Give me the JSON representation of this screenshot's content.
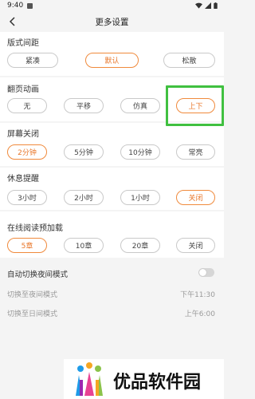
{
  "status_bar": {
    "time": "9:40",
    "icons": [
      "sim-icon",
      "wifi-icon",
      "signal-icon",
      "battery-icon"
    ]
  },
  "header": {
    "title": "更多设置",
    "back_icon": "chevron-left-icon"
  },
  "sections": {
    "layout_spacing": {
      "title": "版式间距",
      "options": [
        "紧凑",
        "默认",
        "松散"
      ],
      "selected": "默认"
    },
    "page_animation": {
      "title": "翻页动画",
      "options": [
        "无",
        "平移",
        "仿真",
        "上下"
      ],
      "selected": "上下"
    },
    "screen_off": {
      "title": "屏幕关闭",
      "options": [
        "2分钟",
        "5分钟",
        "10分钟",
        "常亮"
      ],
      "selected": "2分钟"
    },
    "rest_reminder": {
      "title": "休息提醒",
      "options": [
        "3小时",
        "2小时",
        "1小时",
        "关闭"
      ],
      "selected": "关闭"
    },
    "online_preload": {
      "title": "在线阅读预加载",
      "options": [
        "5章",
        "10章",
        "20章",
        "关闭"
      ],
      "selected": "5章"
    }
  },
  "night_mode": {
    "auto_switch_label": "自动切换夜间模式",
    "auto_switch_enabled": false,
    "to_night_label": "切换至夜间模式",
    "to_night_time": "下午11:30",
    "to_day_label": "切换至日间模式",
    "to_day_time": "上午6:00"
  },
  "colors": {
    "accent": "#f08a3c",
    "highlight": "#40c040",
    "background": "#f4f4f4"
  },
  "watermark": {
    "text": "优品软件园"
  }
}
